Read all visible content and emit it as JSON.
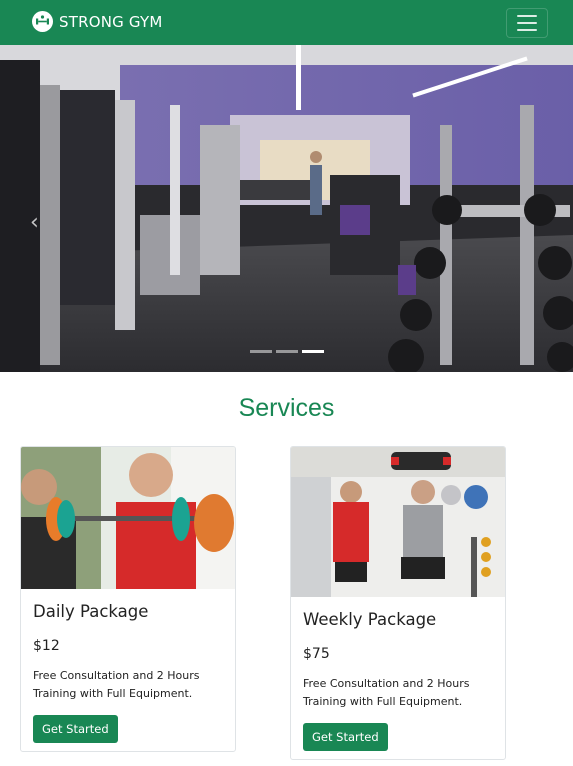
{
  "navbar": {
    "brand": "STRONG GYM",
    "logo_icon": "dumbbell-logo-icon",
    "toggler_icon": "hamburger-menu-icon",
    "background": "#198754"
  },
  "hero": {
    "image": "gym-interior-photo",
    "prev_icon": "chevron-left-icon",
    "prev_label": "‹",
    "slide_count": 3,
    "active_slide": 3
  },
  "services": {
    "title": "Services",
    "cards": [
      {
        "title": "Daily Package",
        "price": "$12",
        "description": "Free Consultation and 2 Hours Training with Full Equipment.",
        "button": "Get Started",
        "image": "trainer-barbell-photo"
      },
      {
        "title": "Weekly Package",
        "price": "$75",
        "description": "Free Consultation and 2 Hours Training with Full Equipment.",
        "button": "Get Started",
        "image": "partner-medicine-ball-photo"
      }
    ]
  },
  "colors": {
    "accent": "#198754",
    "text": "#222222"
  }
}
